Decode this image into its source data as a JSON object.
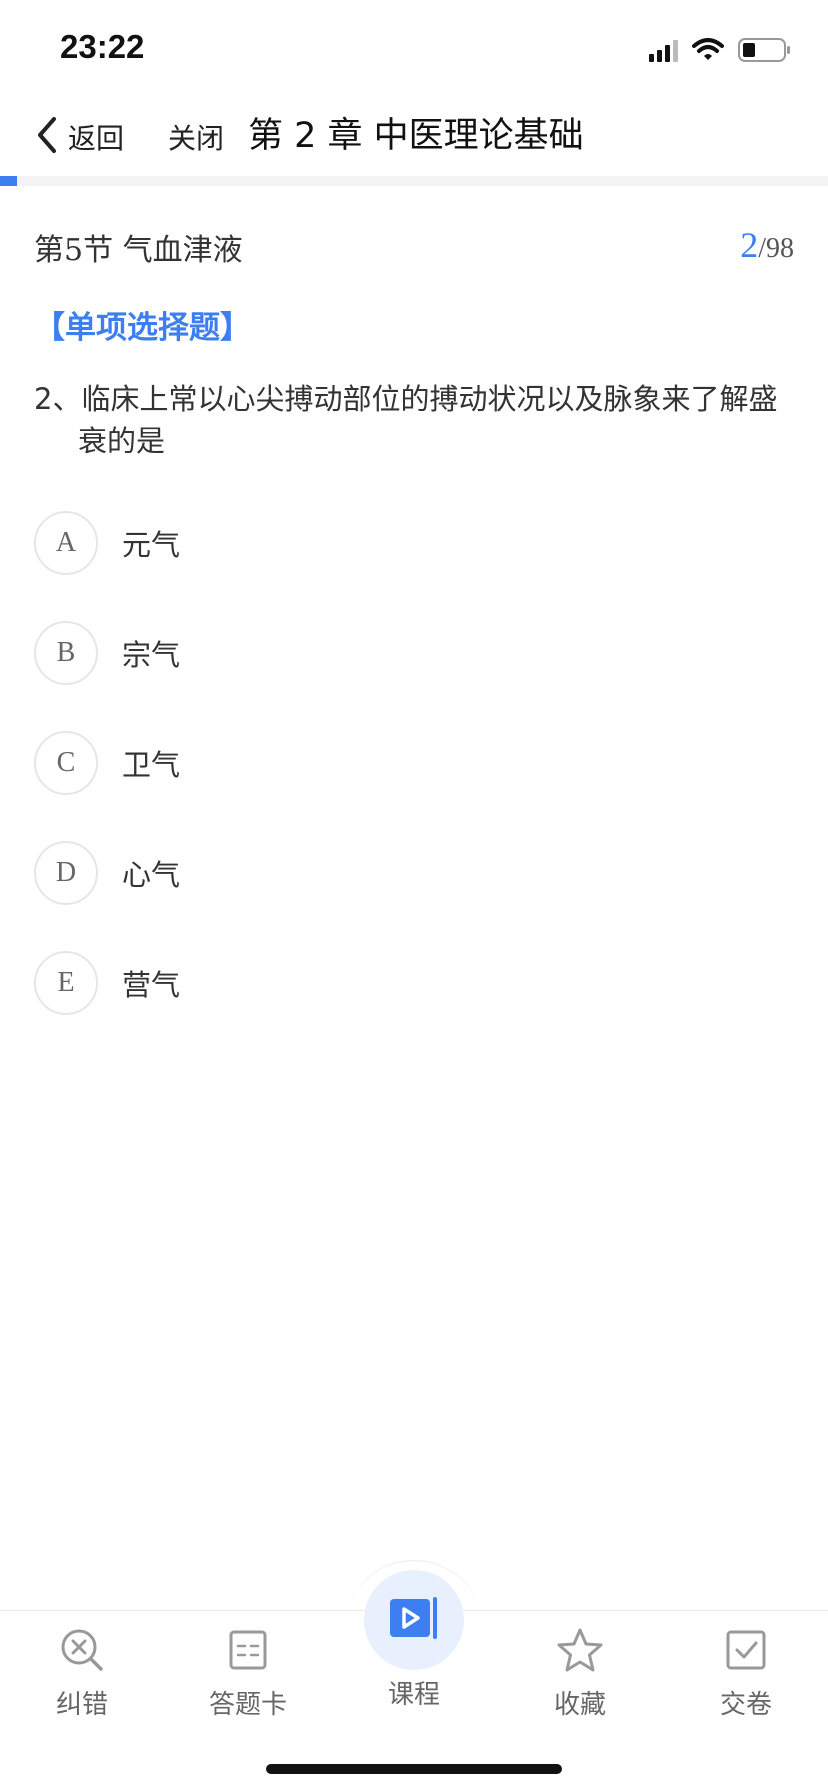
{
  "status_bar": {
    "time": "23:22"
  },
  "nav": {
    "back_label": "返回",
    "close_label": "关闭",
    "title": "第 2 章 中医理论基础"
  },
  "progress": {
    "fraction": 0.0204
  },
  "section": {
    "title": "第5节 气血津液",
    "current": "2",
    "separator": "/",
    "total": "98"
  },
  "question": {
    "type": "【单项选择题】",
    "text": "2、临床上常以心尖搏动部位的搏动状况以及脉象来了解盛衰的是"
  },
  "options": [
    {
      "letter": "A",
      "text": "元气"
    },
    {
      "letter": "B",
      "text": "宗气"
    },
    {
      "letter": "C",
      "text": "卫气"
    },
    {
      "letter": "D",
      "text": "心气"
    },
    {
      "letter": "E",
      "text": "营气"
    }
  ],
  "toolbar": {
    "error_label": "纠错",
    "answer_card_label": "答题卡",
    "course_label": "课程",
    "favorite_label": "收藏",
    "submit_label": "交卷"
  },
  "colors": {
    "accent": "#3d7ff0",
    "text": "#333333",
    "muted": "#666666"
  },
  "icons": [
    "back-chevron-icon",
    "signal-icon",
    "wifi-icon",
    "battery-icon",
    "search-error-icon",
    "answer-card-icon",
    "video-play-icon",
    "star-icon",
    "checkbox-icon"
  ]
}
